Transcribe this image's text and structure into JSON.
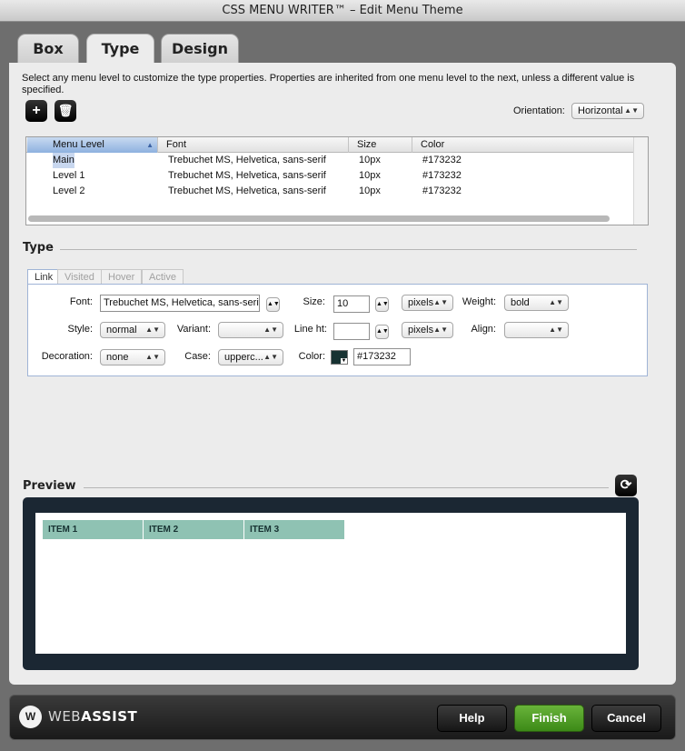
{
  "window": {
    "title": "CSS MENU WRITER™ – Edit Menu Theme"
  },
  "tabs": [
    {
      "label": "Box"
    },
    {
      "label": "Type"
    },
    {
      "label": "Design"
    }
  ],
  "description": "Select any menu level to customize the type properties. Properties are inherited from one menu level to the next, unless a different value is specified.",
  "toolbar": {
    "add_icon": "plus-icon",
    "delete_icon": "trash-icon"
  },
  "orientation": {
    "label": "Orientation:",
    "value": "Horizontal"
  },
  "levels_table": {
    "columns": [
      "Menu Level",
      "Font",
      "Size",
      "Color"
    ],
    "rows": [
      {
        "level": "Main",
        "font": "Trebuchet MS, Helvetica, sans-serif",
        "size": "10px",
        "color": "#173232"
      },
      {
        "level": "Level 1",
        "font": "Trebuchet MS, Helvetica, sans-serif",
        "size": "10px",
        "color": "#173232"
      },
      {
        "level": "Level 2",
        "font": "Trebuchet MS, Helvetica, sans-serif",
        "size": "10px",
        "color": "#173232"
      }
    ]
  },
  "type_section": {
    "title": "Type",
    "subtabs": [
      "Link",
      "Visited",
      "Hover",
      "Active"
    ],
    "fields": {
      "font_label": "Font:",
      "font_value": "Trebuchet MS, Helvetica, sans-serif",
      "size_label": "Size:",
      "size_value": "10",
      "size_unit": "pixels",
      "weight_label": "Weight:",
      "weight_value": "bold",
      "style_label": "Style:",
      "style_value": "normal",
      "variant_label": "Variant:",
      "variant_value": "",
      "lineht_label": "Line ht:",
      "lineht_value": "",
      "lineht_unit": "pixels",
      "align_label": "Align:",
      "align_value": "",
      "decoration_label": "Decoration:",
      "decoration_value": "none",
      "case_label": "Case:",
      "case_value": "upperc...",
      "color_label": "Color:",
      "color_value": "#173232"
    }
  },
  "preview": {
    "title": "Preview",
    "refresh_icon": "refresh-icon",
    "items": [
      "ITEM 1",
      "ITEM 2",
      "ITEM 3"
    ]
  },
  "footer": {
    "logo_mark": "W",
    "logo_text_light": "WEB",
    "logo_text_bold": "ASSIST",
    "help": "Help",
    "finish": "Finish",
    "cancel": "Cancel"
  },
  "colors": {
    "menu_item_bg": "#8fc2b3",
    "text_color": "#173232",
    "finish_green": "#4f9d24",
    "preview_bg": "#1b2733"
  }
}
